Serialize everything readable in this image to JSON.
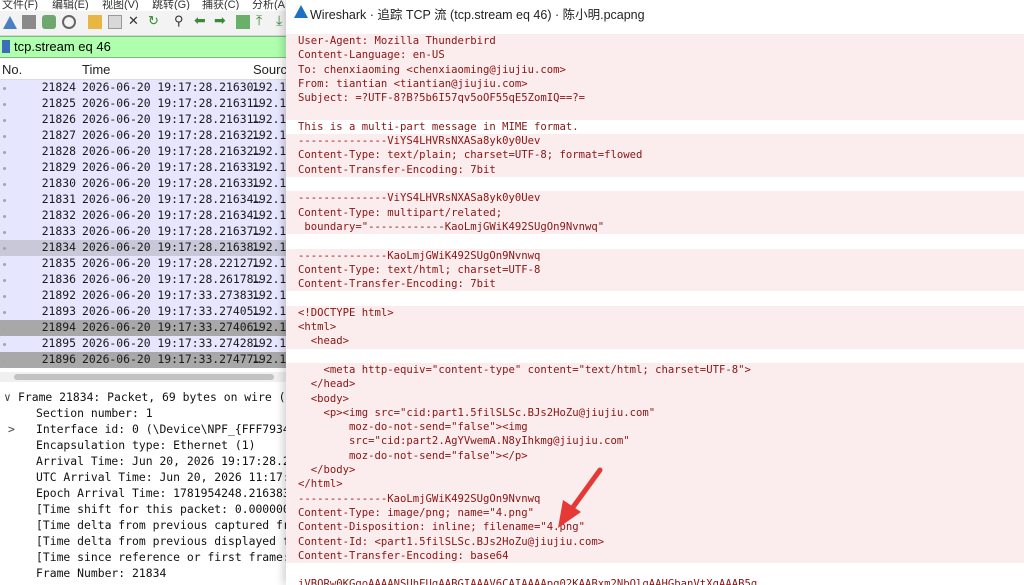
{
  "menubar": [
    "文件(F)",
    "编辑(E)",
    "视图(V)",
    "跳转(G)",
    "捕获(C)",
    "分析(A"
  ],
  "filter": {
    "value": "tcp.stream eq 46"
  },
  "packet_list": {
    "columns": [
      "No.",
      "Time",
      "Sourc"
    ],
    "rows": [
      {
        "no": "21824",
        "time": "2026-06-20 19:17:28.21630…",
        "src": "192.1"
      },
      {
        "no": "21825",
        "time": "2026-06-20 19:17:28.21631…",
        "src": "192.1"
      },
      {
        "no": "21826",
        "time": "2026-06-20 19:17:28.21631…",
        "src": "192.1"
      },
      {
        "no": "21827",
        "time": "2026-06-20 19:17:28.21632…",
        "src": "192.1"
      },
      {
        "no": "21828",
        "time": "2026-06-20 19:17:28.21632…",
        "src": "192.1"
      },
      {
        "no": "21829",
        "time": "2026-06-20 19:17:28.21633…",
        "src": "192.1"
      },
      {
        "no": "21830",
        "time": "2026-06-20 19:17:28.21633…",
        "src": "192.1"
      },
      {
        "no": "21831",
        "time": "2026-06-20 19:17:28.21634…",
        "src": "192.1"
      },
      {
        "no": "21832",
        "time": "2026-06-20 19:17:28.21634…",
        "src": "192.1"
      },
      {
        "no": "21833",
        "time": "2026-06-20 19:17:28.21637…",
        "src": "192.1"
      },
      {
        "no": "21834",
        "time": "2026-06-20 19:17:28.21638…",
        "src": "192.1"
      },
      {
        "no": "21835",
        "time": "2026-06-20 19:17:28.22127…",
        "src": "192.1"
      },
      {
        "no": "21836",
        "time": "2026-06-20 19:17:28.26178…",
        "src": "192.1"
      },
      {
        "no": "21892",
        "time": "2026-06-20 19:17:33.27383…",
        "src": "192.1"
      },
      {
        "no": "21893",
        "time": "2026-06-20 19:17:33.27405…",
        "src": "192.1"
      },
      {
        "no": "21894",
        "time": "2026-06-20 19:17:33.27406…",
        "src": "192.1"
      },
      {
        "no": "21895",
        "time": "2026-06-20 19:17:33.27428…",
        "src": "192.1"
      },
      {
        "no": "21896",
        "time": "2026-06-20 19:17:33.27477…",
        "src": "192.1"
      }
    ]
  },
  "details": [
    {
      "arrow": "∨",
      "text": "Frame 21834: Packet, 69 bytes on wire (552"
    },
    {
      "arrow": "",
      "text": "Section number: 1"
    },
    {
      "arrow": ">",
      "text": "Interface id: 0 (\\Device\\NPF_{FFF79344-"
    },
    {
      "arrow": "",
      "text": "Encapsulation type: Ethernet (1)"
    },
    {
      "arrow": "",
      "text": "Arrival Time: Jun 20, 2026 19:17:28.216"
    },
    {
      "arrow": "",
      "text": "UTC Arrival Time: Jun 20, 2026 11:17:28"
    },
    {
      "arrow": "",
      "text": "Epoch Arrival Time: 1781954248.21638310"
    },
    {
      "arrow": "",
      "text": "[Time shift for this packet: 0.00000000"
    },
    {
      "arrow": "",
      "text": "[Time delta from previous captured fram"
    },
    {
      "arrow": "",
      "text": "[Time delta from previous displayed fra"
    },
    {
      "arrow": "",
      "text": "[Time since reference or first frame: 8"
    },
    {
      "arrow": "",
      "text": "Frame Number: 21834"
    }
  ],
  "dialog": {
    "title": "Wireshark · 追踪 TCP 流 (tcp.stream eq 46) · 陈小明.pcapng",
    "lines": [
      "User-Agent: Mozilla Thunderbird",
      "Content-Language: en-US",
      "To: chenxiaoming <chenxiaoming@jiujiu.com>",
      "From: tiantian <tiantian@jiujiu.com>",
      "Subject: =?UTF-8?B?5b6I57qv5oOF55qE5ZomIQ==?=",
      "",
      "This is a multi-part message in MIME format.",
      "--------------ViYS4LHVRsNXASa8yk0y0Uev",
      "Content-Type: text/plain; charset=UTF-8; format=flowed",
      "Content-Transfer-Encoding: 7bit",
      "",
      "--------------ViYS4LHVRsNXASa8yk0y0Uev",
      "Content-Type: multipart/related;",
      " boundary=\"------------KaoLmjGWiK492SUgOn9Nvnwq\"",
      "",
      "--------------KaoLmjGWiK492SUgOn9Nvnwq",
      "Content-Type: text/html; charset=UTF-8",
      "Content-Transfer-Encoding: 7bit",
      "",
      "<!DOCTYPE html>",
      "<html>",
      "  <head>",
      "",
      "    <meta http-equiv=\"content-type\" content=\"text/html; charset=UTF-8\">",
      "  </head>",
      "  <body>",
      "    <p><img src=\"cid:part1.5filSLSc.BJs2HoZu@jiujiu.com\"",
      "        moz-do-not-send=\"false\"><img",
      "        src=\"cid:part2.AgYVwemA.N8yIhkmg@jiujiu.com\"",
      "        moz-do-not-send=\"false\"></p>",
      "  </body>",
      "</html>",
      "--------------KaoLmjGWiK492SUgOn9Nvnwq",
      "Content-Type: image/png; name=\"4.png\"",
      "Content-Disposition: inline; filename=\"4.png\"",
      "Content-Id: <part1.5filSLSc.BJs2HoZu@jiujiu.com>",
      "Content-Transfer-Encoding: base64",
      "",
      "iVBORw0KGgoAAAANSUhEUgAABGIAAAV6CAIAAAApg02KAABxm2NbOlqAAHGbanVtXgAAAB5g"
    ]
  }
}
